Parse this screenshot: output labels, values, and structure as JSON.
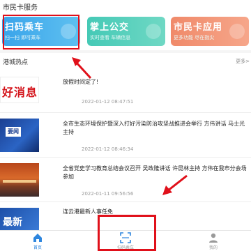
{
  "section": {
    "title": "市民卡服务"
  },
  "cards": [
    {
      "title": "扫码乘车",
      "sub": "扫一扫 即可乘车"
    },
    {
      "title": "掌上公交",
      "sub": "实时查看 车辆信息"
    },
    {
      "title": "市民卡应用",
      "sub": "更多功能 尽在指尖"
    }
  ],
  "news": {
    "header": "港城热点",
    "more": "更多>",
    "items": [
      {
        "thumb_text": "好消息",
        "headline": "放假时间定了!",
        "time": "2022-01-12 08:47:51"
      },
      {
        "thumb_text": "要闻",
        "headline": "全市生态环境保护暨深入打好污染防治攻坚战推进会举行 方伟讲话 马士光主持",
        "time": "2022-01-12 08:46:34"
      },
      {
        "thumb_text": "",
        "headline": "全省党史学习教育总结会议召开 吴政隆讲话 许昆林主持 方伟在我市分会场参加",
        "time": "2022-01-11 09:56:56"
      },
      {
        "thumb_text": "最新",
        "headline": "连云港最新人事任免",
        "time": ""
      }
    ]
  },
  "tabbar": {
    "tabs": [
      {
        "label": "首页"
      },
      {
        "label": "扫码乘车"
      },
      {
        "label": "我的"
      }
    ]
  },
  "colors": {
    "accent": "#2e86de",
    "highlight": "#e0101a"
  }
}
